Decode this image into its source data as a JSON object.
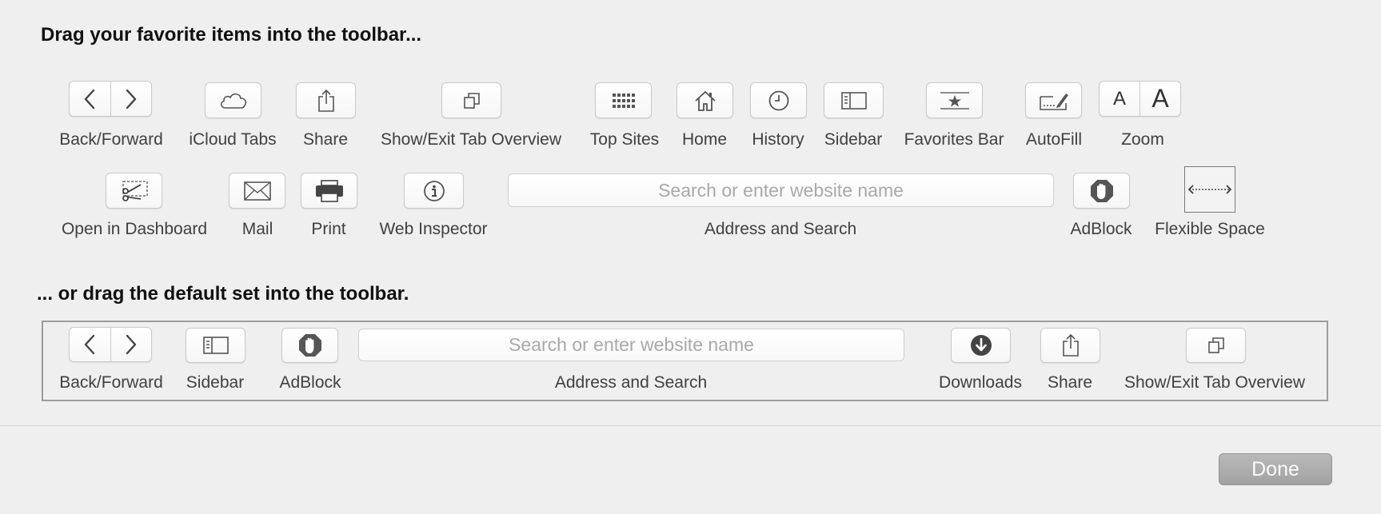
{
  "headings": {
    "favorites": "Drag your favorite items into the toolbar...",
    "default_set": "... or drag the default set into the toolbar."
  },
  "items": {
    "back_forward": "Back/Forward",
    "icloud_tabs": "iCloud Tabs",
    "share": "Share",
    "tab_overview": "Show/Exit Tab Overview",
    "top_sites": "Top Sites",
    "home": "Home",
    "history": "History",
    "sidebar": "Sidebar",
    "favorites_bar": "Favorites Bar",
    "autofill": "AutoFill",
    "zoom": "Zoom",
    "zoom_small_glyph": "A",
    "zoom_big_glyph": "A",
    "open_in_dashboard": "Open in Dashboard",
    "mail": "Mail",
    "print": "Print",
    "web_inspector": "Web Inspector",
    "address_and_search": "Address and Search",
    "search_placeholder": "Search or enter website name",
    "adblock": "AdBlock",
    "flexible_space": "Flexible Space"
  },
  "default_set": {
    "back_forward": "Back/Forward",
    "sidebar": "Sidebar",
    "adblock": "AdBlock",
    "search_placeholder": "Search or enter website name",
    "address_and_search": "Address and Search",
    "downloads": "Downloads",
    "share": "Share",
    "tab_overview": "Show/Exit Tab Overview"
  },
  "footer": {
    "done_label": "Done"
  },
  "colors": {
    "background": "#efefef",
    "icon": "#555555",
    "done_button": "#a9a9a9"
  }
}
